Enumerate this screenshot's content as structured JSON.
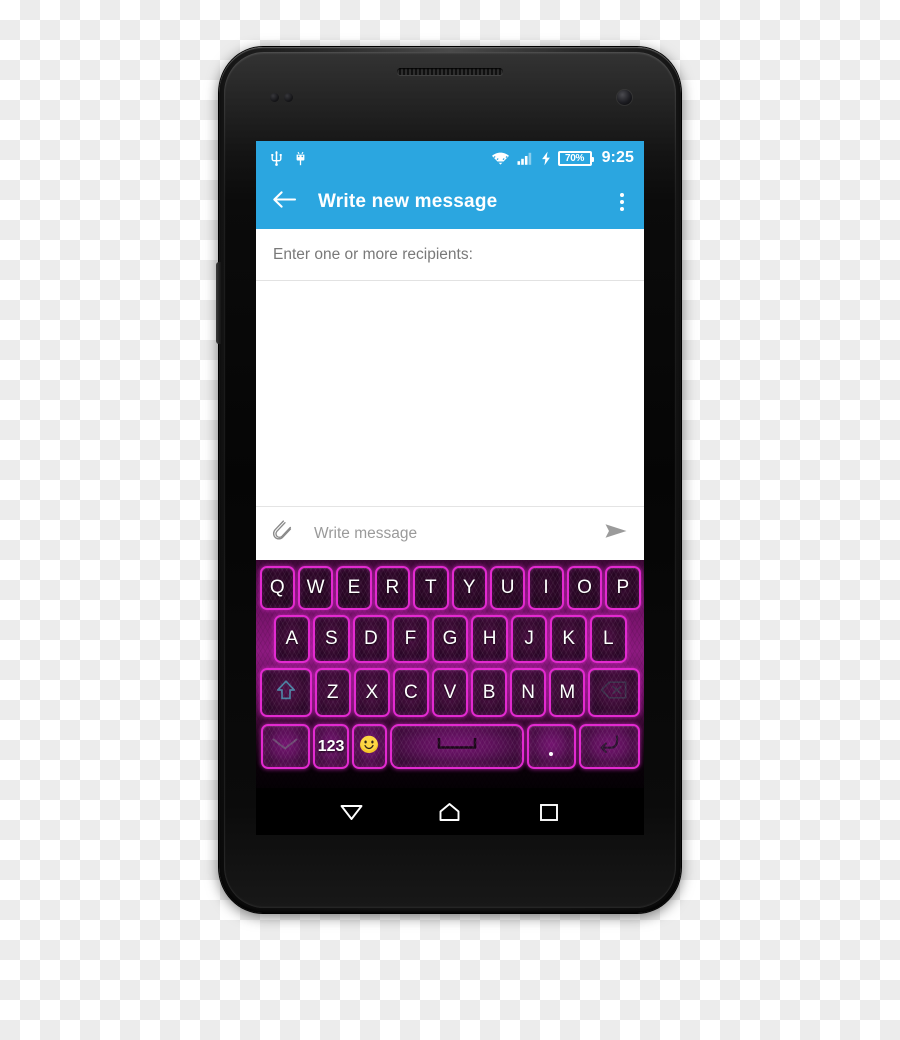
{
  "device": {
    "name": "android-smartphone-mockup",
    "frame_color": "#1a1a1a",
    "earpiece": "earpiece-speaker",
    "camera": "front-camera"
  },
  "status_bar": {
    "background": "#2ba6e0",
    "left_icons": [
      "usb-icon",
      "android-debug-icon"
    ],
    "right_icons": [
      "wifi-icon",
      "cellular-signal-icon",
      "charging-bolt-icon"
    ],
    "battery_level": "70%",
    "time": "9:25"
  },
  "app_bar": {
    "background": "#2ba6e0",
    "back_icon": "back-arrow-icon",
    "title": "Write new message",
    "overflow_icon": "overflow-menu-icon"
  },
  "content": {
    "recipients_placeholder": "Enter one or more recipients:",
    "compose": {
      "attach_icon": "paperclip-icon",
      "placeholder": "Write message",
      "send_icon": "send-arrow-icon"
    }
  },
  "keyboard": {
    "theme_name": "purple-neon-keyboard",
    "accent_color": "#e22ad0",
    "key_background": "#1a0418",
    "rows": [
      {
        "id": "row-1",
        "keys": [
          "Q",
          "W",
          "E",
          "R",
          "T",
          "Y",
          "U",
          "I",
          "O",
          "P"
        ]
      },
      {
        "id": "row-2",
        "keys": [
          "A",
          "S",
          "D",
          "F",
          "G",
          "H",
          "J",
          "K",
          "L"
        ]
      },
      {
        "id": "row-3",
        "keys": [
          "Z",
          "X",
          "C",
          "V",
          "B",
          "N",
          "M"
        ]
      }
    ],
    "shift_key": {
      "name": "shift-key",
      "icon": "shift-arrow-icon"
    },
    "backspace_key": {
      "name": "backspace-key",
      "icon": "backspace-icon"
    },
    "hide_key": {
      "name": "hide-keyboard-key",
      "icon": "chevron-down-icon"
    },
    "numeric_key": {
      "name": "numeric-mode-key",
      "label": "123"
    },
    "emoji_key": {
      "name": "emoji-key",
      "icon": "smiley-face-icon",
      "glyph": "😊"
    },
    "space_key": {
      "name": "space-key",
      "icon": "spacebar-icon"
    },
    "period_key": {
      "name": "period-key",
      "label": "."
    },
    "enter_key": {
      "name": "enter-key",
      "icon": "return-arrow-icon"
    }
  },
  "nav_bar": {
    "background": "#000000",
    "buttons": [
      {
        "name": "nav-back-button",
        "icon": "back-triangle-icon"
      },
      {
        "name": "nav-home-button",
        "icon": "home-icon"
      },
      {
        "name": "nav-recents-button",
        "icon": "recents-square-icon"
      }
    ]
  }
}
